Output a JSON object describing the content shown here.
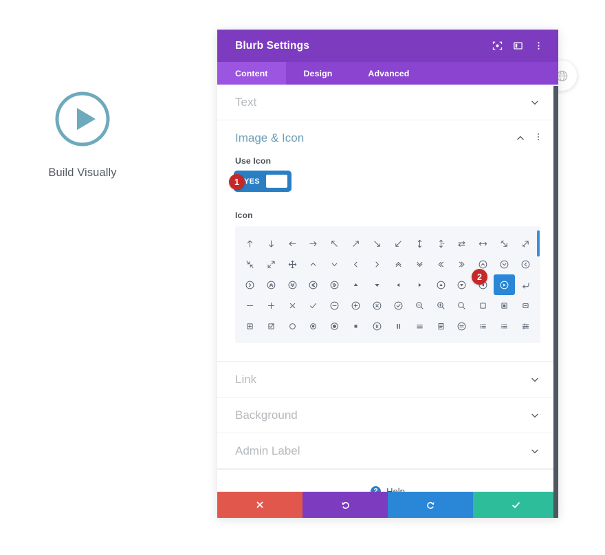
{
  "preview": {
    "icon_name": "play-circle-outline-icon",
    "icon_color": "#6eaabb",
    "title": "Build Visually"
  },
  "page_badge": {
    "icon_name": "globe-icon"
  },
  "modal": {
    "title": "Blurb Settings",
    "titlebar_icons": [
      {
        "name": "expand-frame-icon"
      },
      {
        "name": "split-layout-icon"
      },
      {
        "name": "vertical-dots-icon"
      }
    ],
    "tabs": [
      {
        "label": "Content",
        "active": true
      },
      {
        "label": "Design",
        "active": false
      },
      {
        "label": "Advanced",
        "active": false
      }
    ],
    "sections": {
      "text": {
        "label": "Text",
        "state": "collapsed",
        "chevron": "chevron-down-icon"
      },
      "image_icon": {
        "label": "Image & Icon",
        "state": "expanded",
        "chevron": "chevron-up-icon",
        "menu_icon": "vertical-dots-icon",
        "use_icon": {
          "label": "Use Icon",
          "value": "YES",
          "badge": "1"
        },
        "icon_field": {
          "label": "Icon",
          "selected_index": 40,
          "selected_icon_name": "play-circle-icon",
          "badge": "2",
          "icons": [
            "arrow-up",
            "arrow-down",
            "arrow-left",
            "arrow-right",
            "arrow-up-left",
            "arrow-up-right",
            "arrow-down-right",
            "arrow-down-left",
            "arrows-vertical",
            "arrows-vertical-split",
            "arrows-left-right-tail",
            "arrows-horizontal",
            "arrow-resize-down-right",
            "arrow-resize-up-right",
            "arrows-collapse",
            "arrows-expand",
            "arrows-move",
            "chevron-up",
            "chevron-down",
            "chevron-left",
            "chevron-right",
            "chevrons-up",
            "chevrons-down",
            "chevrons-left",
            "chevrons-right",
            "circle-chevron-up",
            "circle-chevron-down",
            "circle-chevron-left",
            "circle-chevron-right",
            "circle-chevrons-up",
            "circle-chevrons-down",
            "circle-chevrons-left",
            "circle-chevrons-right",
            "triangle-up",
            "triangle-down",
            "triangle-left",
            "triangle-right",
            "circle-triangle-up",
            "circle-triangle-down",
            "circle-triangle-left",
            "play-circle",
            "arrow-return-left",
            "minus",
            "plus",
            "times",
            "check",
            "circle-minus",
            "circle-plus",
            "circle-times",
            "circle-check",
            "zoom-out",
            "zoom-in",
            "search",
            "square-outline",
            "square-filled-inset",
            "square-minus",
            "square-plus",
            "checkbox-checked",
            "circle-outline",
            "radio-selected",
            "circle-dot-filled",
            "square-small-filled",
            "circle-pause",
            "pause",
            "list-lines",
            "document-lines",
            "circle-lines",
            "list-bullets",
            "list-dashes",
            "sliders"
          ]
        }
      },
      "link": {
        "label": "Link",
        "state": "collapsed",
        "chevron": "chevron-down-icon"
      },
      "background": {
        "label": "Background",
        "state": "collapsed",
        "chevron": "chevron-down-icon"
      },
      "admin_label": {
        "label": "Admin Label",
        "state": "collapsed",
        "chevron": "chevron-down-icon"
      }
    },
    "help": {
      "label": "Help",
      "icon_name": "help-question-icon"
    },
    "actions": [
      {
        "name": "cancel-button",
        "icon": "close-x-icon",
        "color": "#e2574c"
      },
      {
        "name": "undo-button",
        "icon": "undo-arrow-icon",
        "color": "#7d3cc0"
      },
      {
        "name": "redo-button",
        "icon": "redo-arrow-icon",
        "color": "#2a86d6"
      },
      {
        "name": "save-button",
        "icon": "check-icon",
        "color": "#2ebd9a"
      }
    ]
  },
  "colors": {
    "titlebar_purple": "#7d3cc0",
    "tabbar_purple": "#8a44cf",
    "tab_active_purple": "#9b55e0",
    "section_title_teal": "#6c9eb8",
    "toggle_blue": "#2a7ec4",
    "selected_icon_blue": "#2a86d6",
    "badge_red": "#c62828"
  }
}
